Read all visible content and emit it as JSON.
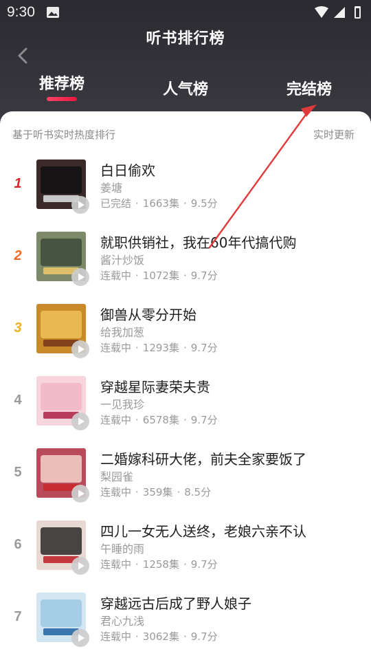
{
  "status": {
    "time": "9:30"
  },
  "header": {
    "title": "听书排行榜",
    "tabs": [
      {
        "label": "推荐榜",
        "active": true
      },
      {
        "label": "人气榜",
        "active": false
      },
      {
        "label": "完结榜",
        "active": false
      }
    ]
  },
  "list": {
    "subtitle": "基于听书实时热度排行",
    "update_label": "实时更新",
    "items": [
      {
        "rank": "1",
        "title": "白日偷欢",
        "author": "姜塘",
        "status": "已完结",
        "episodes": "1663集",
        "score": "9.5分",
        "rank_color": "#d8262c"
      },
      {
        "rank": "2",
        "title": "就职供销社，我在60年代搞代购",
        "author": "酱汁炒饭",
        "status": "连载中",
        "episodes": "1072集",
        "score": "9.7分",
        "rank_color": "#ee6a24"
      },
      {
        "rank": "3",
        "title": "御兽从零分开始",
        "author": "给我加葱",
        "status": "连载中",
        "episodes": "1293集",
        "score": "9.7分",
        "rank_color": "#f0b020"
      },
      {
        "rank": "4",
        "title": "穿越星际妻荣夫贵",
        "author": "一见我珍",
        "status": "连载中",
        "episodes": "6578集",
        "score": "9.7分",
        "rank_color": "#9a9a9a"
      },
      {
        "rank": "5",
        "title": "二婚嫁科研大佬，前夫全家要饭了",
        "author": "梨园雀",
        "status": "连载中",
        "episodes": "359集",
        "score": "8.5分",
        "rank_color": "#9a9a9a"
      },
      {
        "rank": "6",
        "title": "四儿一女无人送终，老娘六亲不认",
        "author": "午睡的雨",
        "status": "连载中",
        "episodes": "1258集",
        "score": "9.7分",
        "rank_color": "#9a9a9a"
      },
      {
        "rank": "7",
        "title": "穿越远古后成了野人娘子",
        "author": "君心九浅",
        "status": "连载中",
        "episodes": "3062集",
        "score": "9.7分",
        "rank_color": "#9a9a9a"
      }
    ]
  },
  "colors": {
    "tab_indicator": "#e8173f",
    "annotation_arrow": "#e03a3a"
  },
  "icons": {
    "back": "chevron-left-icon",
    "play": "play-icon"
  }
}
